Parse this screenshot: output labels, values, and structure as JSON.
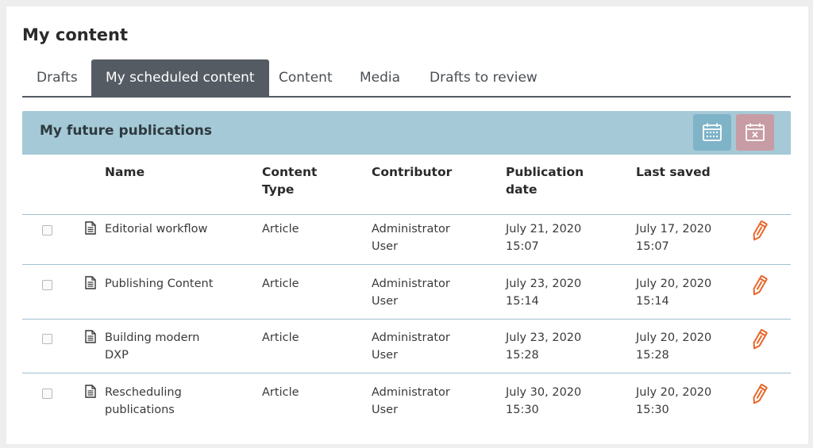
{
  "page": {
    "title": "My content"
  },
  "tabs": [
    {
      "label": "Drafts"
    },
    {
      "label": "My scheduled content"
    },
    {
      "label": "Content"
    },
    {
      "label": "Media"
    },
    {
      "label": "Drafts to review"
    }
  ],
  "active_tab": "My scheduled content",
  "panel": {
    "title": "My future publications",
    "actions": [
      {
        "name": "schedule",
        "icon": "calendar-icon"
      },
      {
        "name": "unschedule",
        "icon": "calendar-remove-icon"
      }
    ]
  },
  "table": {
    "columns": {
      "name": "Name",
      "content_type": "Content Type",
      "contributor": "Contributor",
      "publication_date": "Publication date",
      "last_saved": "Last saved"
    },
    "rows": [
      {
        "name": "Editorial workflow",
        "content_type": "Article",
        "contributor": "Administrator User",
        "publication_date": "July 21, 2020 15:07",
        "last_saved": "July 17, 2020 15:07"
      },
      {
        "name": "Publishing Content",
        "content_type": "Article",
        "contributor": "Administrator User",
        "publication_date": "July 23, 2020 15:14",
        "last_saved": "July 20, 2020 15:14"
      },
      {
        "name": "Building modern DXP",
        "content_type": "Article",
        "contributor": "Administrator User",
        "publication_date": "July 23, 2020 15:28",
        "last_saved": "July 20, 2020 15:28"
      },
      {
        "name": "Rescheduling publications",
        "content_type": "Article",
        "contributor": "Administrator User",
        "publication_date": "July 30, 2020 15:30",
        "last_saved": "July 20, 2020 15:30"
      }
    ]
  },
  "colors": {
    "active_tab": "#545b63",
    "panel_header": "#a5c9d6",
    "schedule_button": "#7fb3c8",
    "unschedule_button": "#c79ca4",
    "edit_icon": "#e8672a"
  }
}
